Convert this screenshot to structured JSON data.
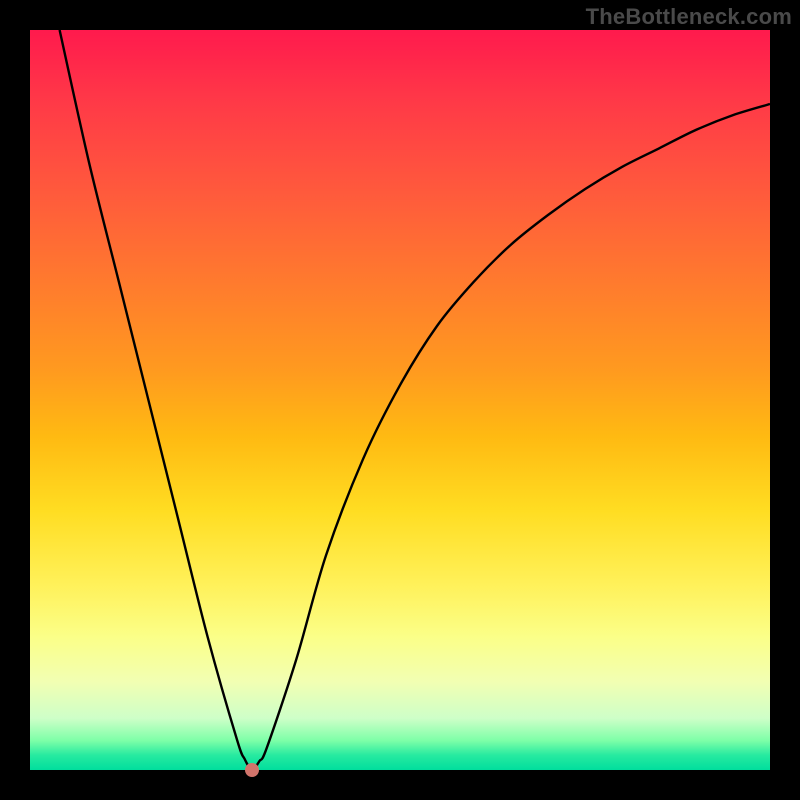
{
  "watermark_text": "TheBottleneck.com",
  "chart_data": {
    "type": "line",
    "title": "",
    "xlabel": "",
    "ylabel": "",
    "xlim": [
      0,
      100
    ],
    "ylim": [
      0,
      100
    ],
    "grid": false,
    "legend": false,
    "series": [
      {
        "name": "curve",
        "x": [
          4,
          8,
          12,
          16,
          20,
          24,
          28,
          29,
          30,
          31,
          32,
          36,
          40,
          45,
          50,
          55,
          60,
          65,
          70,
          75,
          80,
          85,
          90,
          95,
          100
        ],
        "y": [
          100,
          82,
          66,
          50,
          34,
          18,
          4,
          1.5,
          0,
          1.2,
          3,
          15,
          29,
          42,
          52,
          60,
          66,
          71,
          75,
          78.5,
          81.5,
          84,
          86.5,
          88.5,
          90
        ]
      }
    ],
    "marker": {
      "x": 30,
      "y": 0
    },
    "background_gradient": {
      "type": "vertical",
      "stops": [
        {
          "pos": 0.0,
          "color": "#ff1a4d"
        },
        {
          "pos": 0.55,
          "color": "#ffba12"
        },
        {
          "pos": 0.82,
          "color": "#fbff88"
        },
        {
          "pos": 1.0,
          "color": "#00de9d"
        }
      ]
    }
  }
}
